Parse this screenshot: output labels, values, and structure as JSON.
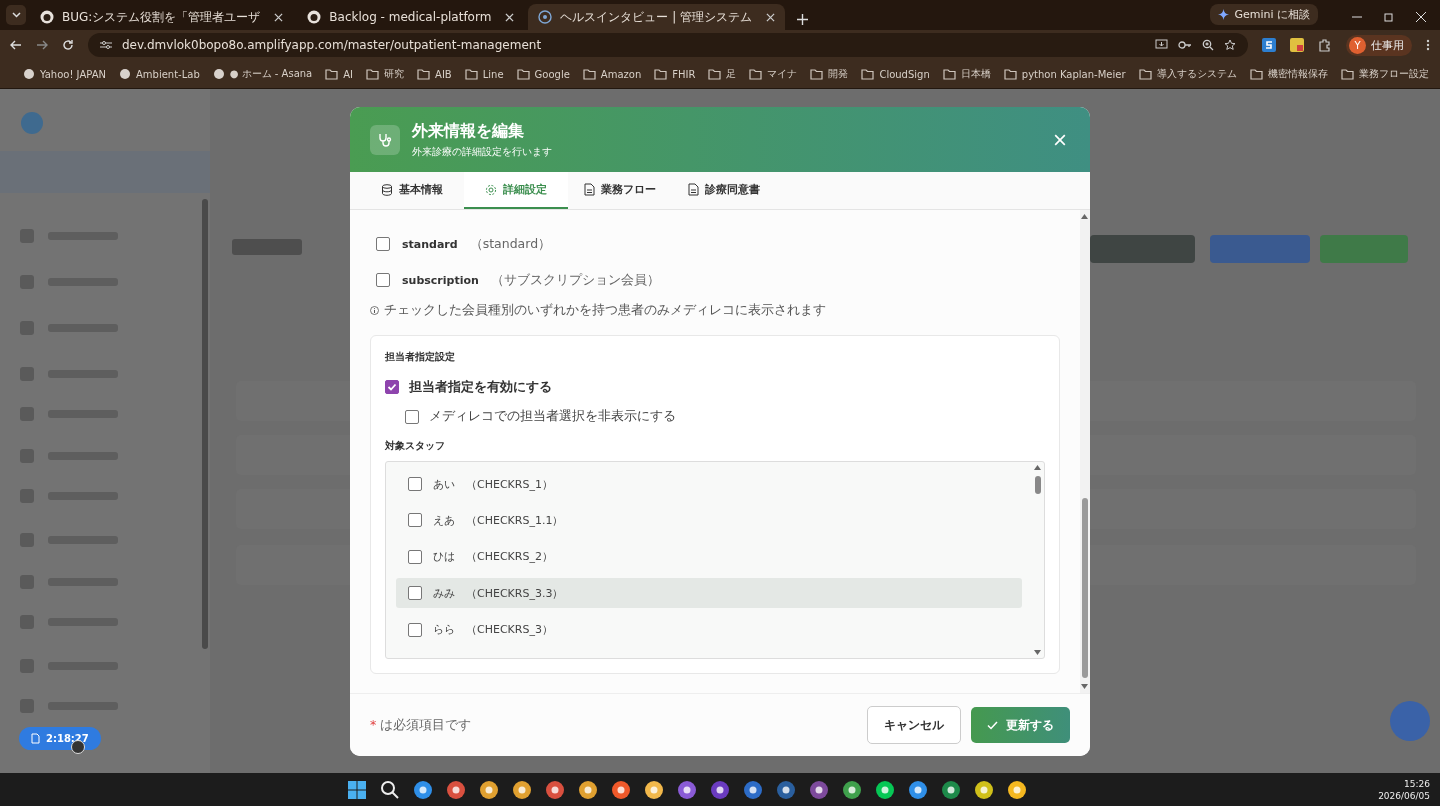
{
  "browser": {
    "tabs": [
      {
        "title": "BUG:システム役割を「管理者ユーザ",
        "selected": false
      },
      {
        "title": "Backlog - medical-platform",
        "selected": false
      },
      {
        "title": "ヘルスインタビュー | 管理システム",
        "selected": true
      }
    ],
    "gemini_button": "Gemini に相談",
    "address": "dev.dmvlok0bopo8o.amplifyapp.com/master/outpatient-management",
    "profile_initial": "Y",
    "profile_label": "仕事用",
    "bookmarks": [
      {
        "label": "Yahoo! JAPAN",
        "kind": "site"
      },
      {
        "label": "Ambient-Lab",
        "kind": "site"
      },
      {
        "label": "● ホーム - Asana",
        "kind": "site"
      },
      {
        "label": "AI",
        "kind": "folder"
      },
      {
        "label": "研究",
        "kind": "folder"
      },
      {
        "label": "AIB",
        "kind": "folder"
      },
      {
        "label": "Line",
        "kind": "folder"
      },
      {
        "label": "Google",
        "kind": "folder"
      },
      {
        "label": "Amazon",
        "kind": "folder"
      },
      {
        "label": "FHIR",
        "kind": "folder"
      },
      {
        "label": "足",
        "kind": "folder"
      },
      {
        "label": "マイナ",
        "kind": "folder"
      },
      {
        "label": "開発",
        "kind": "folder"
      },
      {
        "label": "CloudSign",
        "kind": "folder"
      },
      {
        "label": "日本橋",
        "kind": "folder"
      },
      {
        "label": "python Kaplan-Meier",
        "kind": "folder"
      },
      {
        "label": "導入するシステム",
        "kind": "folder"
      },
      {
        "label": "機密情報保存",
        "kind": "folder"
      },
      {
        "label": "業務フロー設定",
        "kind": "folder"
      }
    ]
  },
  "timer_badge": "2:18:27",
  "modal": {
    "title": "外来情報を編集",
    "subtitle": "外来診療の詳細設定を行います",
    "tabs": [
      {
        "label": "基本情報",
        "selected": false
      },
      {
        "label": "詳細設定",
        "selected": true
      },
      {
        "label": "業務フロー",
        "selected": false
      },
      {
        "label": "診療同意書",
        "selected": false
      }
    ],
    "member_types": [
      {
        "name": "standard",
        "note": "（standard）",
        "checked": false
      },
      {
        "name": "subscription",
        "note": "（サブスクリプション会員）",
        "checked": false
      }
    ],
    "member_hint": "チェックした会員種別のいずれかを持つ患者のみメディレコに表示されます",
    "assignee_section": {
      "title": "担当者指定設定",
      "enable": {
        "label": "担当者指定を有効にする",
        "checked": true
      },
      "hide": {
        "label": "メディレコでの担当者選択を非表示にする",
        "checked": false
      },
      "staff_label": "対象スタッフ",
      "staff": [
        {
          "name": "あい",
          "code": "（CHECKRS_1）",
          "checked": false,
          "hovered": false
        },
        {
          "name": "えあ",
          "code": "（CHECKRS_1.1）",
          "checked": false,
          "hovered": false
        },
        {
          "name": "ひは",
          "code": "（CHECKRS_2）",
          "checked": false,
          "hovered": false
        },
        {
          "name": "みみ",
          "code": "（CHECKRS_3.3）",
          "checked": false,
          "hovered": true
        },
        {
          "name": "らら",
          "code": "（CHECKRS_3）",
          "checked": false,
          "hovered": false
        }
      ]
    },
    "required_mark": "*",
    "required_note": "は必須項目です",
    "cancel": "キャンセル",
    "submit": "更新する"
  },
  "taskbar": {
    "time": "15:26",
    "date": "2026/06/05"
  }
}
